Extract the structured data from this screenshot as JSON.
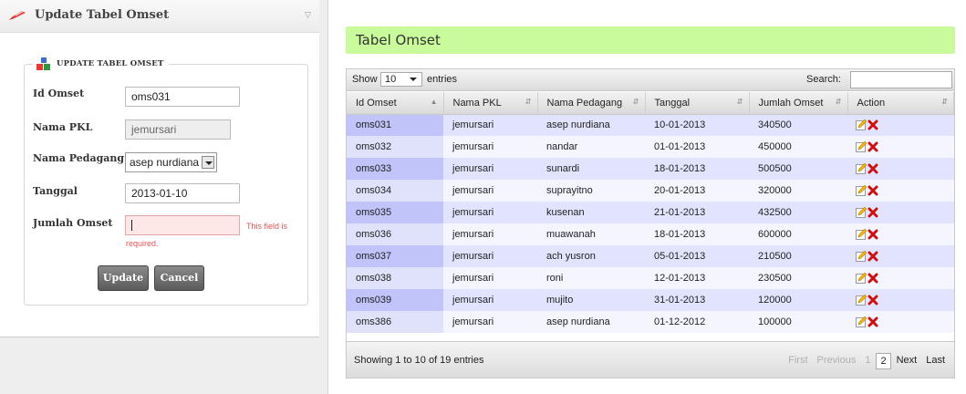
{
  "panel": {
    "title": "Update Tabel Omset",
    "legend": "UPDATE TABEL OMSET"
  },
  "form": {
    "id_omset": {
      "label": "Id Omset",
      "value": "oms031"
    },
    "nama_pkl": {
      "label": "Nama PKL",
      "value": "jemursari"
    },
    "nama_pedagang": {
      "label": "Nama Pedagang",
      "value": "asep nurdiana"
    },
    "tanggal": {
      "label": "Tanggal",
      "value": "2013-01-10"
    },
    "jumlah_omset": {
      "label": "Jumlah Omset",
      "value": ""
    },
    "error_part1": "This  field  is",
    "error_part2": "required.",
    "update_label": "Update",
    "cancel_label": "Cancel"
  },
  "table_panel": {
    "title": "Tabel Omset",
    "show_label": "Show",
    "page_length": "10",
    "entries_label": "entries",
    "search_label": "Search:",
    "columns": [
      "Id Omset",
      "Nama PKL",
      "Nama Pedagang",
      "Tanggal",
      "Jumlah Omset",
      "Action"
    ],
    "rows": [
      [
        "oms031",
        "jemursari",
        "asep nurdiana",
        "10-01-2013",
        "340500"
      ],
      [
        "oms032",
        "jemursari",
        "nandar",
        "01-01-2013",
        "450000"
      ],
      [
        "oms033",
        "jemursari",
        "sunardi",
        "18-01-2013",
        "500500"
      ],
      [
        "oms034",
        "jemursari",
        "suprayitno",
        "20-01-2013",
        "320000"
      ],
      [
        "oms035",
        "jemursari",
        "kusenan",
        "21-01-2013",
        "432500"
      ],
      [
        "oms036",
        "jemursari",
        "muawanah",
        "18-01-2013",
        "600000"
      ],
      [
        "oms037",
        "jemursari",
        "ach yusron",
        "05-01-2013",
        "210500"
      ],
      [
        "oms038",
        "jemursari",
        "roni",
        "12-01-2013",
        "230500"
      ],
      [
        "oms039",
        "jemursari",
        "mujito",
        "31-01-2013",
        "120000"
      ],
      [
        "oms386",
        "jemursari",
        "asep nurdiana",
        "01-12-2012",
        "100000"
      ]
    ],
    "info": "Showing 1 to 10 of 19 entries",
    "pager": {
      "first": "First",
      "previous": "Previous",
      "page1": "1",
      "page2": "2",
      "next": "Next",
      "last": "Last"
    }
  },
  "colors": {
    "title_bg": "#c9fa9b",
    "row_odd": "#e2e4ff",
    "row_even": "#f5f5ff",
    "error_red": "#e05555"
  }
}
